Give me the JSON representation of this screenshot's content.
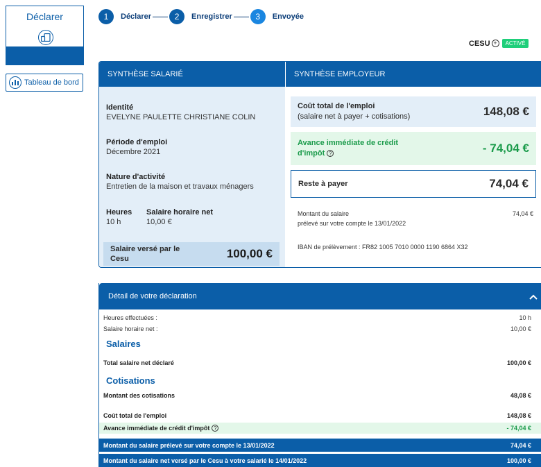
{
  "nav": {
    "declarer_label": "Déclarer",
    "tableau_label": "Tableau de bord"
  },
  "stepper": {
    "steps": [
      {
        "num": "1",
        "label": "Déclarer"
      },
      {
        "num": "2",
        "label": "Enregistrer"
      },
      {
        "num": "3",
        "label": "Envoyée"
      }
    ]
  },
  "cesu": {
    "label": "CESU",
    "badge": "ACTIVÉ"
  },
  "salarie": {
    "header": "SYNTHÈSE SALARIÉ",
    "identite_label": "Identité",
    "identite_value": "EVELYNE PAULETTE CHRISTIANE COLIN",
    "periode_label": "Période d'emploi",
    "periode_value": "Décembre 2021",
    "nature_label": "Nature d'activité",
    "nature_value": "Entretien de la maison et travaux ménagers",
    "heures_label": "Heures",
    "heures_value": "10 h",
    "taux_label": "Salaire horaire net",
    "taux_value": "10,00 €",
    "verse_label": "Salaire versé par le Cesu",
    "verse_amount": "100,00 €"
  },
  "employeur": {
    "header": "SYNTHÈSE EMPLOYEUR",
    "cout_label": "Coût total de l'emploi",
    "cout_sub": "(salaire net à payer + cotisations)",
    "cout_amount": "148,08 €",
    "avance_label": "Avance immédiate de crédit d'impôt",
    "avance_amount": "- 74,04 €",
    "reste_label": "Reste à payer",
    "reste_amount": "74,04 €",
    "montant_label": "Montant du salaire",
    "montant_sub": "prélevé sur votre compte le 13/01/2022",
    "montant_amount": "74,04 €",
    "iban": "IBAN de prélèvement : FR82 1005 7010 0000 1190 6864 X32"
  },
  "detail": {
    "header": "Détail de votre déclaration",
    "heures_label": "Heures effectuées :",
    "heures_value": "10 h",
    "taux_label": "Salaire horaire net :",
    "taux_value": "10,00 €",
    "salaires_title": "Salaires",
    "total_salaire_label": "Total salaire net déclaré",
    "total_salaire_value": "100,00 €",
    "cotisations_title": "Cotisations",
    "montant_cot_label": "Montant des cotisations",
    "montant_cot_value": "48,08 €",
    "cout_label": "Coût total de l'emploi",
    "cout_value": "148,08 €",
    "avance_label": "Avance immédiate de crédit d'impôt",
    "avance_value": "- 74,04 €",
    "preleve_label": "Montant du salaire prélevé sur votre compte le 13/01/2022",
    "preleve_value": "74,04 €",
    "verse_label": "Montant du salaire net versé par le Cesu à votre salarié le 14/01/2022",
    "verse_value": "100,00 €"
  },
  "colors": {
    "primary": "#0b5ea8",
    "green": "#1b9b4b",
    "light_blue": "#e3eef8",
    "light_green": "#e3f7e9"
  }
}
